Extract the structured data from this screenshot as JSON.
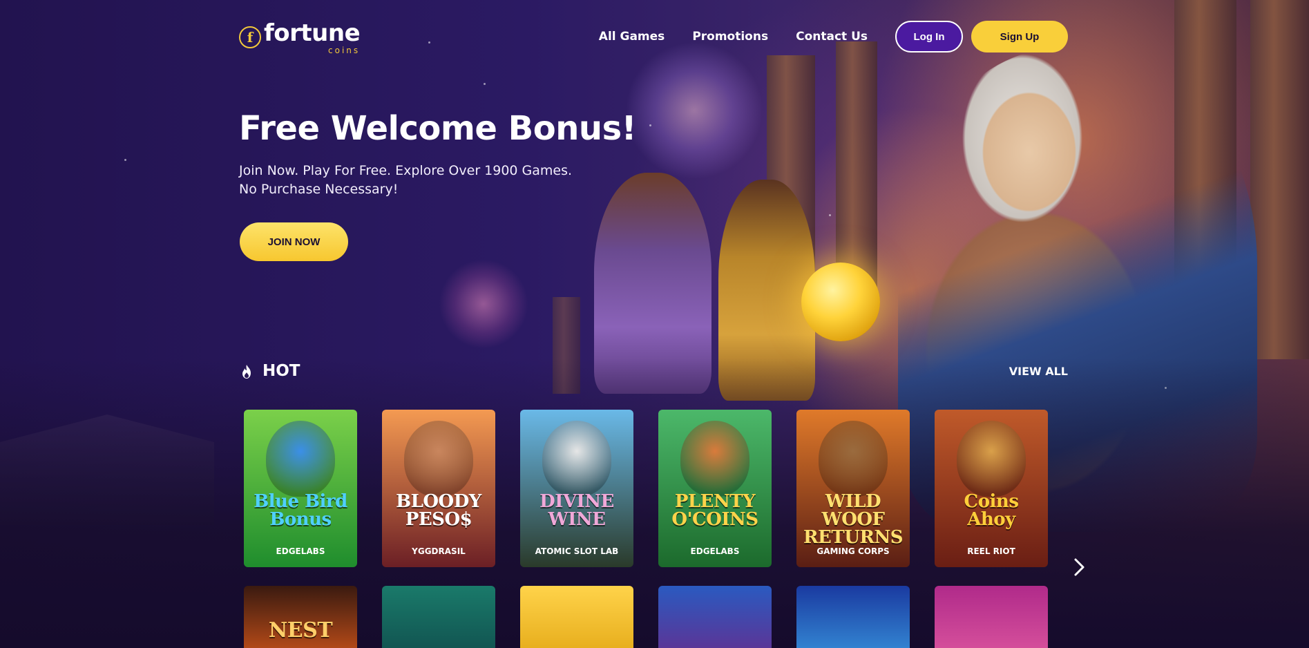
{
  "brand": {
    "logo_mark": "f",
    "name": "fortune",
    "sub": "coins"
  },
  "nav": {
    "links": [
      "All Games",
      "Promotions",
      "Contact Us"
    ],
    "login": "Log In",
    "signup": "Sign Up"
  },
  "hero": {
    "title": "Free Welcome Bonus!",
    "line1": "Join Now. Play For Free. Explore Over 1900 Games.",
    "line2": "No Purchase Necessary!",
    "cta": "JOIN NOW"
  },
  "hot": {
    "label": "HOT",
    "view_all": "VIEW ALL",
    "icon": "flame-icon",
    "games": [
      {
        "title_line1": "Blue Bird",
        "title_line2": "Bonus",
        "provider": "EDGELABS",
        "bg_top": "#7bd04a",
        "bg_bottom": "#1f8d2d",
        "title_color": "#4fd0ff",
        "char_color": "#3b8fe8"
      },
      {
        "title_line1": "BLOODY",
        "title_line2": "PESO$",
        "provider": "YGGDRASIL",
        "bg_top": "#f49a52",
        "bg_bottom": "#6b1f25",
        "title_color": "#ffffff",
        "char_color": "#c9865e"
      },
      {
        "title_line1": "DIVINE",
        "title_line2": "WINE",
        "provider": "ATOMIC SLOT LAB",
        "bg_top": "#6ab9e8",
        "bg_bottom": "#2a3a2a",
        "title_color": "#f0a8d8",
        "char_color": "#e6e6e6"
      },
      {
        "title_line1": "PLENTY",
        "title_line2": "O'COINS",
        "provider": "EDGELABS",
        "bg_top": "#4cb86a",
        "bg_bottom": "#1c6a2c",
        "title_color": "#ffd34a",
        "char_color": "#d97b3c"
      },
      {
        "title_line1": "WILD WOOF",
        "title_line2": "RETURNS",
        "provider": "GAMING CORPS",
        "bg_top": "#e07a2a",
        "bg_bottom": "#5a1e14",
        "title_color": "#ffe070",
        "char_color": "#9a6b3e"
      },
      {
        "title_line1": "Coins",
        "title_line2": "Ahoy",
        "provider": "REEL RIOT",
        "bg_top": "#c05a2a",
        "bg_bottom": "#6a1e14",
        "title_color": "#ffcf3a",
        "char_color": "#d9a04a"
      }
    ],
    "row2": [
      {
        "title": "NEST",
        "bg_top": "#3a1a10",
        "bg_bottom": "#d9581a",
        "title_color": "#ffcf6a"
      },
      {
        "title": "",
        "bg_top": "#1a7a6a",
        "bg_bottom": "#0f4a4a",
        "title_color": "#ffffff"
      },
      {
        "title": "",
        "bg_top": "#ffd34a",
        "bg_bottom": "#e0a310",
        "title_color": "#ffffff"
      },
      {
        "title": "",
        "bg_top": "#2a5ac0",
        "bg_bottom": "#6a2a8a",
        "title_color": "#ffffff"
      },
      {
        "title": "",
        "bg_top": "#1a3aa0",
        "bg_bottom": "#3a9ae0",
        "title_color": "#ffffff"
      },
      {
        "title": "",
        "bg_top": "#b02a8a",
        "bg_bottom": "#e05aa0",
        "title_color": "#ffffff"
      }
    ]
  },
  "colors": {
    "accent_yellow": "#f9cf3a",
    "login_purple": "#4b1aa0",
    "background": "#1a0f3d"
  }
}
